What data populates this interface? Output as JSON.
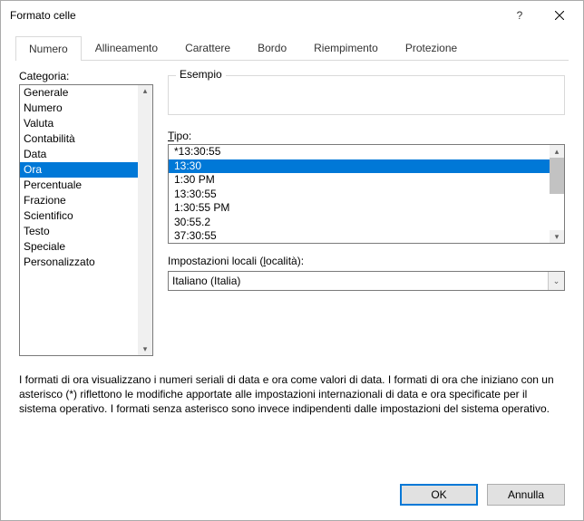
{
  "title": "Formato celle",
  "tabs": [
    {
      "label": "Numero",
      "active": true
    },
    {
      "label": "Allineamento",
      "active": false
    },
    {
      "label": "Carattere",
      "active": false
    },
    {
      "label": "Bordo",
      "active": false
    },
    {
      "label": "Riempimento",
      "active": false
    },
    {
      "label": "Protezione",
      "active": false
    }
  ],
  "category": {
    "label": "Categoria:",
    "items": [
      {
        "label": "Generale"
      },
      {
        "label": "Numero"
      },
      {
        "label": "Valuta"
      },
      {
        "label": "Contabilità"
      },
      {
        "label": "Data"
      },
      {
        "label": "Ora",
        "selected": true
      },
      {
        "label": "Percentuale"
      },
      {
        "label": "Frazione"
      },
      {
        "label": "Scientifico"
      },
      {
        "label": "Testo"
      },
      {
        "label": "Speciale"
      },
      {
        "label": "Personalizzato"
      }
    ]
  },
  "example": {
    "label": "Esempio",
    "value": ""
  },
  "type": {
    "label": "Tipo:",
    "items": [
      {
        "label": "*13:30:55"
      },
      {
        "label": "13:30",
        "selected": true
      },
      {
        "label": "1:30 PM"
      },
      {
        "label": "13:30:55"
      },
      {
        "label": "1:30:55 PM"
      },
      {
        "label": "30:55.2"
      },
      {
        "label": "37:30:55"
      }
    ]
  },
  "locale": {
    "label_pre": "Impostazioni locali (",
    "label_accesskey": "l",
    "label_post": "ocalità):",
    "value": "Italiano (Italia)"
  },
  "description": "I formati di ora visualizzano i numeri seriali di data e ora come valori di data. I formati di ora che iniziano con un asterisco (*) riflettono le modifiche apportate alle impostazioni internazionali di data e ora specificate per il sistema operativo. I formati senza asterisco sono invece indipendenti dalle impostazioni del sistema operativo.",
  "buttons": {
    "ok": "OK",
    "cancel": "Annulla"
  }
}
